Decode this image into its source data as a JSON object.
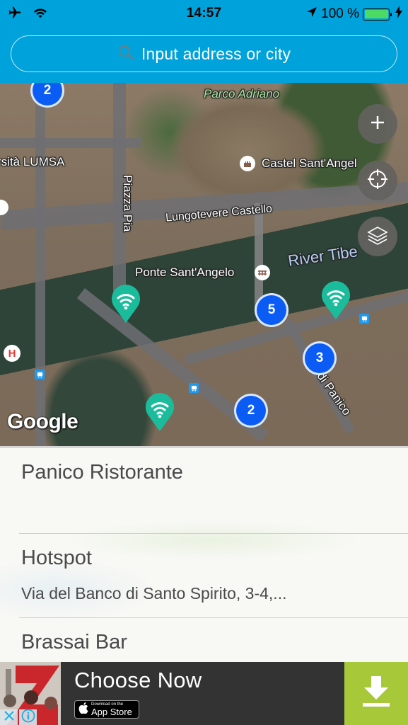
{
  "status_bar": {
    "time": "14:57",
    "battery_percent": "100 %",
    "battery_level": 1.0,
    "icons": [
      "airplane-icon",
      "wifi-icon",
      "location-arrow-icon",
      "battery-icon",
      "charging-bolt-icon"
    ]
  },
  "search": {
    "placeholder": "Input address or city",
    "icon": "search-icon"
  },
  "map": {
    "labels": {
      "parco": "Parco Adriano",
      "castel": "Castel Sant'Angel",
      "lumsa": "rsità LUMSA",
      "piazza": "Piazza Pia",
      "lungotevere": "Lungotevere Castello",
      "ponte": "Ponte Sant'Angelo",
      "river": "River Tibe",
      "panico": "di Panico"
    },
    "clusters": [
      {
        "count": "2"
      },
      {
        "count": "5"
      },
      {
        "count": "3"
      },
      {
        "count": "2"
      }
    ],
    "controls": {
      "zoom_in": "plus-icon",
      "locate": "crosshair-icon",
      "layers": "layers-icon"
    },
    "attribution": "Google",
    "colors": {
      "cluster": "#0a5cf5",
      "hotspot_pin": "#1abc9c"
    }
  },
  "list": {
    "items": [
      {
        "title": "Panico Ristorante",
        "subtitle": ""
      },
      {
        "title": "Hotspot",
        "subtitle": "Via del Banco di Santo Spirito, 3-4,..."
      },
      {
        "title": "Brassai Bar",
        "subtitle": ""
      }
    ]
  },
  "ad": {
    "title": "Choose Now",
    "store_small": "Download on the",
    "store_big": "App Store",
    "download_icon": "download-icon",
    "colors": {
      "background": "#333333",
      "download": "#a7c838"
    }
  },
  "colors": {
    "header": "#00a2db"
  }
}
